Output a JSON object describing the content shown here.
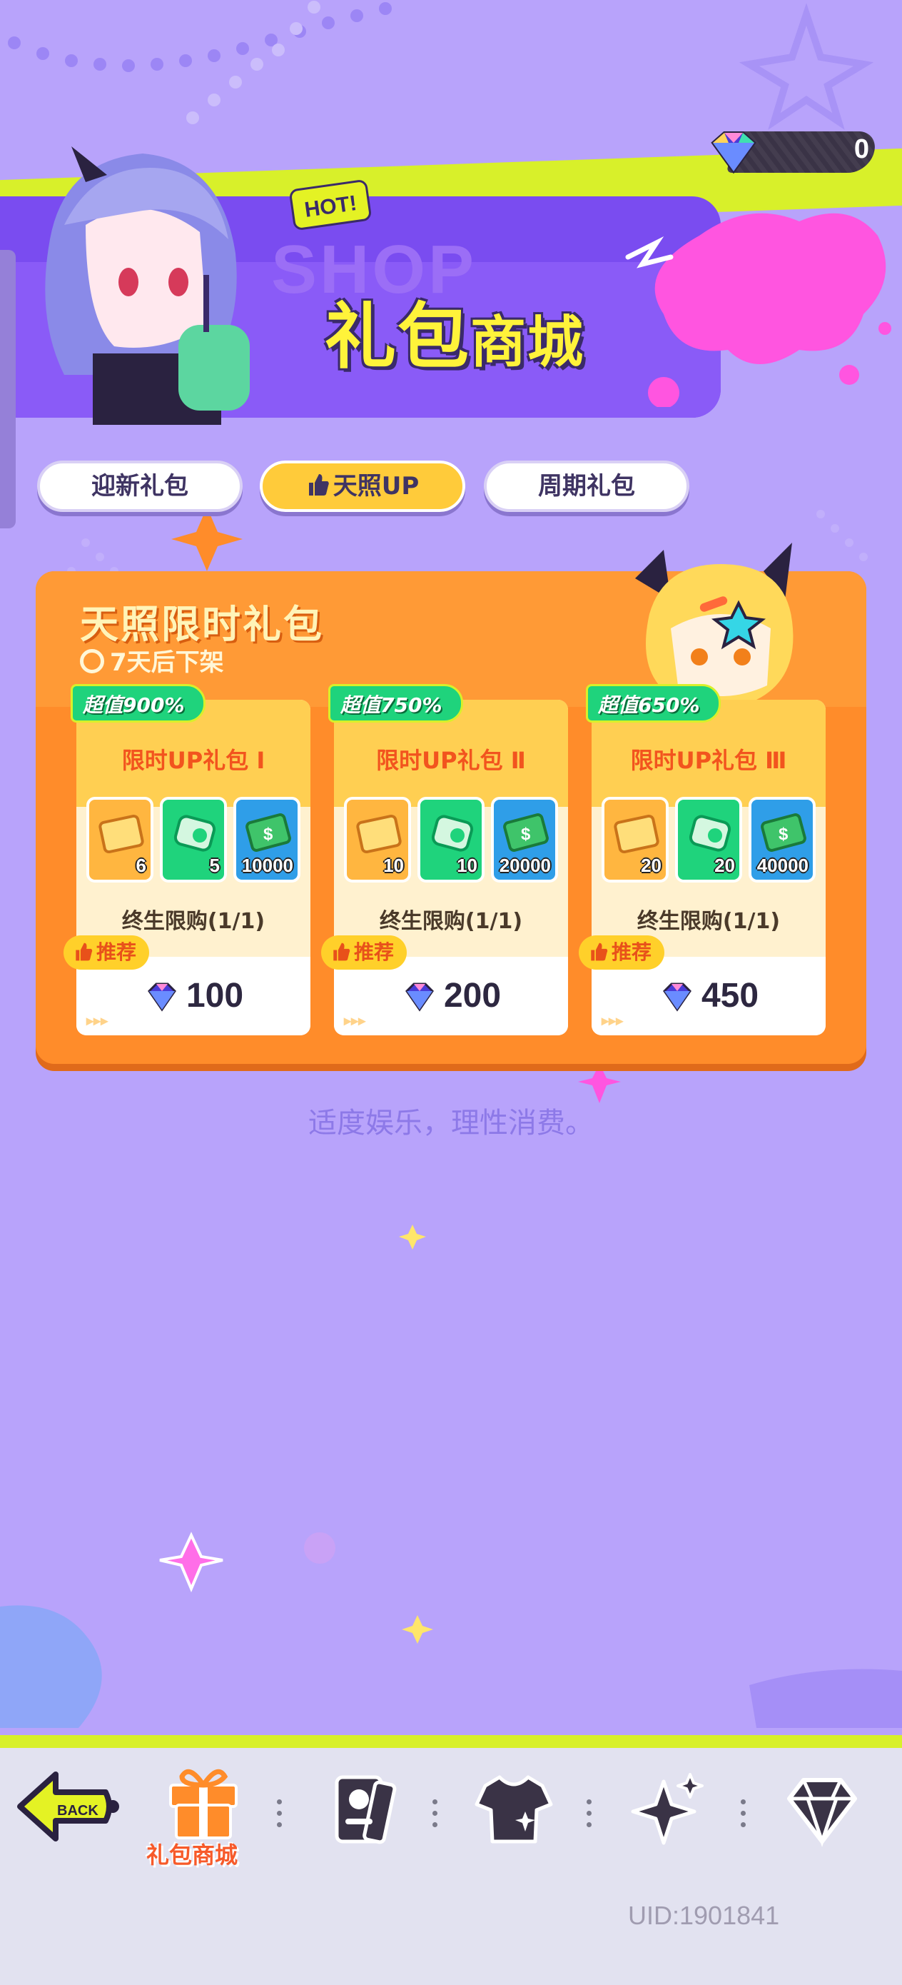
{
  "currency": {
    "amount": "0"
  },
  "banner": {
    "title_a": "礼包",
    "title_b": "商城",
    "hot_badge": "HOT!",
    "ghost_text": "SHOP"
  },
  "tabs": [
    {
      "label": "迎新礼包",
      "active": false
    },
    {
      "label": "天照UP",
      "active": true
    },
    {
      "label": "周期礼包",
      "active": false
    }
  ],
  "panel": {
    "title": "天照限时礼包",
    "timer": "7天后下架",
    "cards": [
      {
        "value_tag": "超值900%",
        "label": "限时UP礼包 Ⅰ",
        "items": [
          {
            "icon": "gold-ticket-icon",
            "count": "6"
          },
          {
            "icon": "green-ticket-icon",
            "count": "5"
          },
          {
            "icon": "cash-icon",
            "count": "10000"
          }
        ],
        "limit": "终生限购(1/1)",
        "recommend": "推荐",
        "price": "100"
      },
      {
        "value_tag": "超值750%",
        "label": "限时UP礼包 Ⅱ",
        "items": [
          {
            "icon": "gold-ticket-icon",
            "count": "10"
          },
          {
            "icon": "green-ticket-icon",
            "count": "10"
          },
          {
            "icon": "cash-icon",
            "count": "20000"
          }
        ],
        "limit": "终生限购(1/1)",
        "recommend": "推荐",
        "price": "200"
      },
      {
        "value_tag": "超值650%",
        "label": "限时UP礼包 Ⅲ",
        "items": [
          {
            "icon": "gold-ticket-icon",
            "count": "20"
          },
          {
            "icon": "green-ticket-icon",
            "count": "20"
          },
          {
            "icon": "cash-icon",
            "count": "40000"
          }
        ],
        "limit": "终生限购(1/1)",
        "recommend": "推荐",
        "price": "450"
      }
    ]
  },
  "footer_note": "适度娱乐，理性消费。",
  "nav": {
    "back": "BACK",
    "active_label": "礼包商城",
    "items": [
      "back-icon",
      "gift-icon",
      "card-icon",
      "shirt-icon",
      "sparkle-icon",
      "diamond-icon"
    ]
  },
  "uid": "UID:1901841",
  "colors": {
    "background": "#b8a3fb",
    "accent_yellow": "#d8f02a",
    "panel_orange": "#ff8c2a",
    "pink": "#ff55e0"
  }
}
